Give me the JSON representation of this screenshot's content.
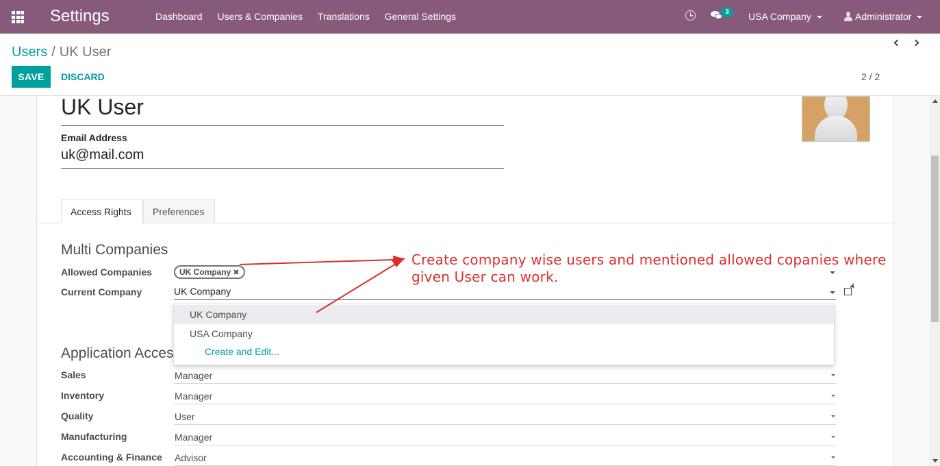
{
  "navbar": {
    "brand": "Settings",
    "menu": [
      "Dashboard",
      "Users & Companies",
      "Translations",
      "General Settings"
    ],
    "message_count": "3",
    "company": "USA Company",
    "user": "Administrator"
  },
  "control_panel": {
    "breadcrumb_parent": "Users",
    "breadcrumb_separator": "/",
    "breadcrumb_current": "UK User",
    "save_label": "SAVE",
    "discard_label": "DISCARD",
    "pager": "2 / 2"
  },
  "form": {
    "name": "UK User",
    "email_label": "Email Address",
    "email_value": "uk@mail.com",
    "tabs": [
      "Access Rights",
      "Preferences"
    ],
    "multi_companies": {
      "title": "Multi Companies",
      "allowed_label": "Allowed Companies",
      "allowed_tag": "UK Company",
      "current_label": "Current Company",
      "current_value": "UK Company"
    },
    "application_access": {
      "title": "Application Access",
      "rows": [
        {
          "label": "Sales",
          "value": "Manager"
        },
        {
          "label": "Inventory",
          "value": "Manager"
        },
        {
          "label": "Quality",
          "value": "User"
        },
        {
          "label": "Manufacturing",
          "value": "Manager"
        },
        {
          "label": "Accounting & Finance",
          "value": "Advisor"
        }
      ]
    }
  },
  "dropdown": {
    "options": [
      "UK Company",
      "USA Company"
    ],
    "create_label": "Create and Edit..."
  },
  "annotation": {
    "text": "Create company wise users and mentioned allowed copanies where given User can work."
  },
  "colors": {
    "navbar": "#875a7b",
    "primary": "#00a09d",
    "annotation": "#e02b2b"
  }
}
